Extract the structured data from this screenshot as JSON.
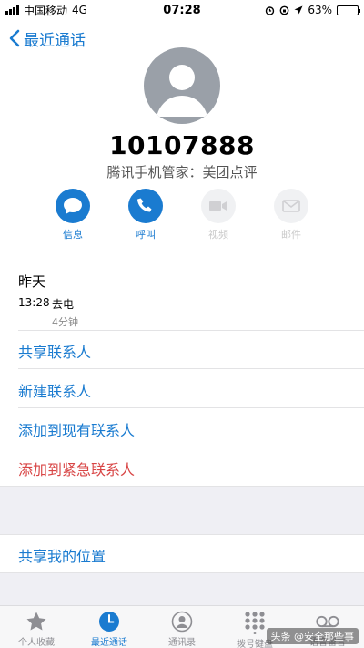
{
  "status_bar": {
    "carrier": "中国移动",
    "network": "4G",
    "time": "07:28",
    "battery": "63%",
    "battery_level": 0.63
  },
  "nav": {
    "back_label": "最近通话"
  },
  "contact": {
    "number": "10107888",
    "tag": "腾讯手机管家：美团点评"
  },
  "actions": [
    {
      "label": "信息",
      "icon": "message-icon",
      "state": "active"
    },
    {
      "label": "呼叫",
      "icon": "phone-icon",
      "state": "active"
    },
    {
      "label": "视频",
      "icon": "video-icon",
      "state": "disabled"
    },
    {
      "label": "邮件",
      "icon": "mail-icon",
      "state": "disabled"
    }
  ],
  "recent": {
    "day": "昨天",
    "time": "13:28",
    "type": "去电",
    "duration": "4分钟"
  },
  "options": {
    "share_contact": "共享联系人",
    "new_contact": "新建联系人",
    "add_existing": "添加到现有联系人",
    "add_emergency": "添加到紧急联系人",
    "share_location": "共享我的位置"
  },
  "tabs": [
    {
      "label": "个人收藏",
      "icon": "star-icon"
    },
    {
      "label": "最近通话",
      "icon": "clock-icon",
      "active": true
    },
    {
      "label": "通讯录",
      "icon": "contacts-icon"
    },
    {
      "label": "拨号键盘",
      "icon": "keypad-icon"
    },
    {
      "label": "语音留言",
      "icon": "voicemail-icon"
    }
  ],
  "watermark": "头条 @安全那些事",
  "colors": {
    "accent": "#1a7bd0",
    "danger": "#d84545",
    "avatar": "#9aa0a8",
    "disabled_bg": "#f0f1f3"
  }
}
